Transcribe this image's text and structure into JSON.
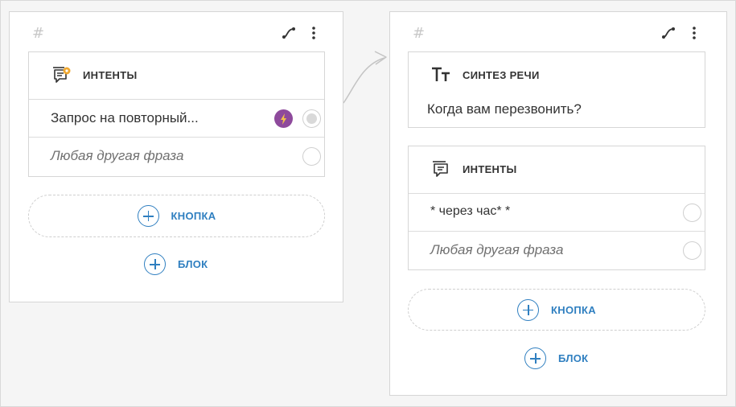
{
  "nodes": [
    {
      "hash": "#",
      "intents": {
        "title": "ИНТЕНТЫ",
        "rows": [
          {
            "text": "Запрос на повторный...",
            "italic": false,
            "has_badge": true,
            "radio_filled": true
          },
          {
            "text": "Любая другая фраза",
            "italic": true,
            "has_badge": false,
            "radio_filled": false
          }
        ]
      },
      "add_button_label": "КНОПКА",
      "add_block_label": "БЛОК"
    },
    {
      "hash": "#",
      "speech": {
        "title": "СИНТЕЗ РЕЧИ",
        "text": "Когда вам перезвонить?"
      },
      "intents": {
        "title": "ИНТЕНТЫ",
        "rows": [
          {
            "text": "* через час* *",
            "italic": false,
            "has_badge": false,
            "radio_filled": false
          },
          {
            "text": "Любая другая фраза",
            "italic": true,
            "has_badge": false,
            "radio_filled": false
          }
        ]
      },
      "add_button_label": "КНОПКА",
      "add_block_label": "БЛОК"
    }
  ],
  "icons": {
    "route": "route-icon",
    "menu": "more-vertical-icon",
    "intents": "chat-lines-icon",
    "intents_ai": "chat-lines-gear-icon",
    "speech": "text-size-icon",
    "trigger": "lightning-icon",
    "add": "plus-circle-icon"
  },
  "colors": {
    "accent": "#2f7fc0",
    "badge": "#8e4a9c",
    "badge_bolt": "#f3c24b",
    "ai_dot": "#f0a830"
  }
}
